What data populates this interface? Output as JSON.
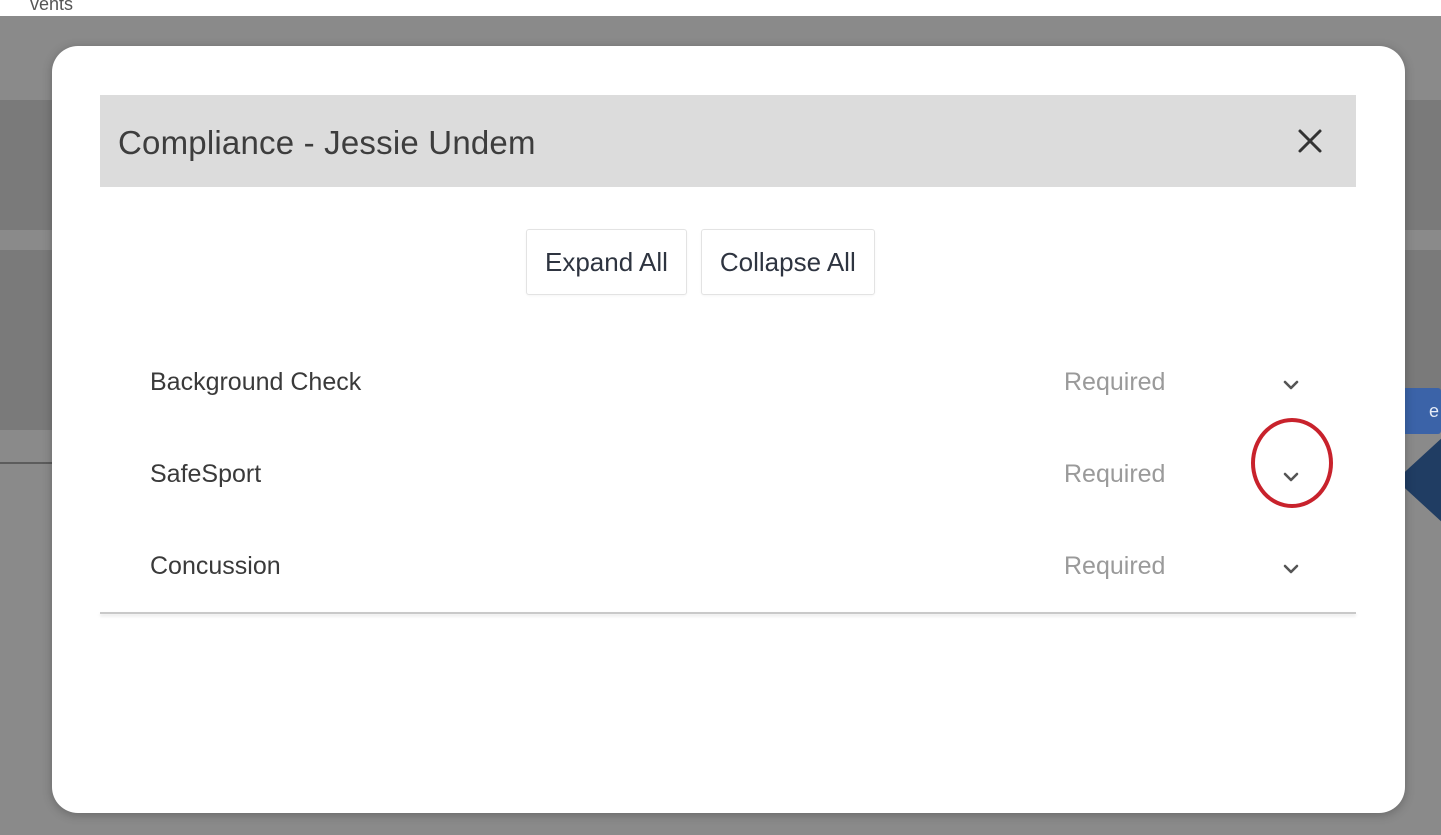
{
  "background": {
    "partial_text": "vents",
    "partial_button_text": "e"
  },
  "modal": {
    "title": "Compliance - Jessie Undem",
    "close_icon": "close-icon",
    "toolbar": {
      "expand_all_label": "Expand All",
      "collapse_all_label": "Collapse All"
    },
    "items": [
      {
        "label": "Background Check",
        "status": "Required",
        "icon": "chevron-down-icon"
      },
      {
        "label": "SafeSport",
        "status": "Required",
        "icon": "chevron-down-icon"
      },
      {
        "label": "Concussion",
        "status": "Required",
        "icon": "chevron-down-icon"
      }
    ]
  },
  "colors": {
    "highlight": "#c8222c",
    "pointer": "#203d63",
    "header_bg": "#dcdcdc"
  }
}
